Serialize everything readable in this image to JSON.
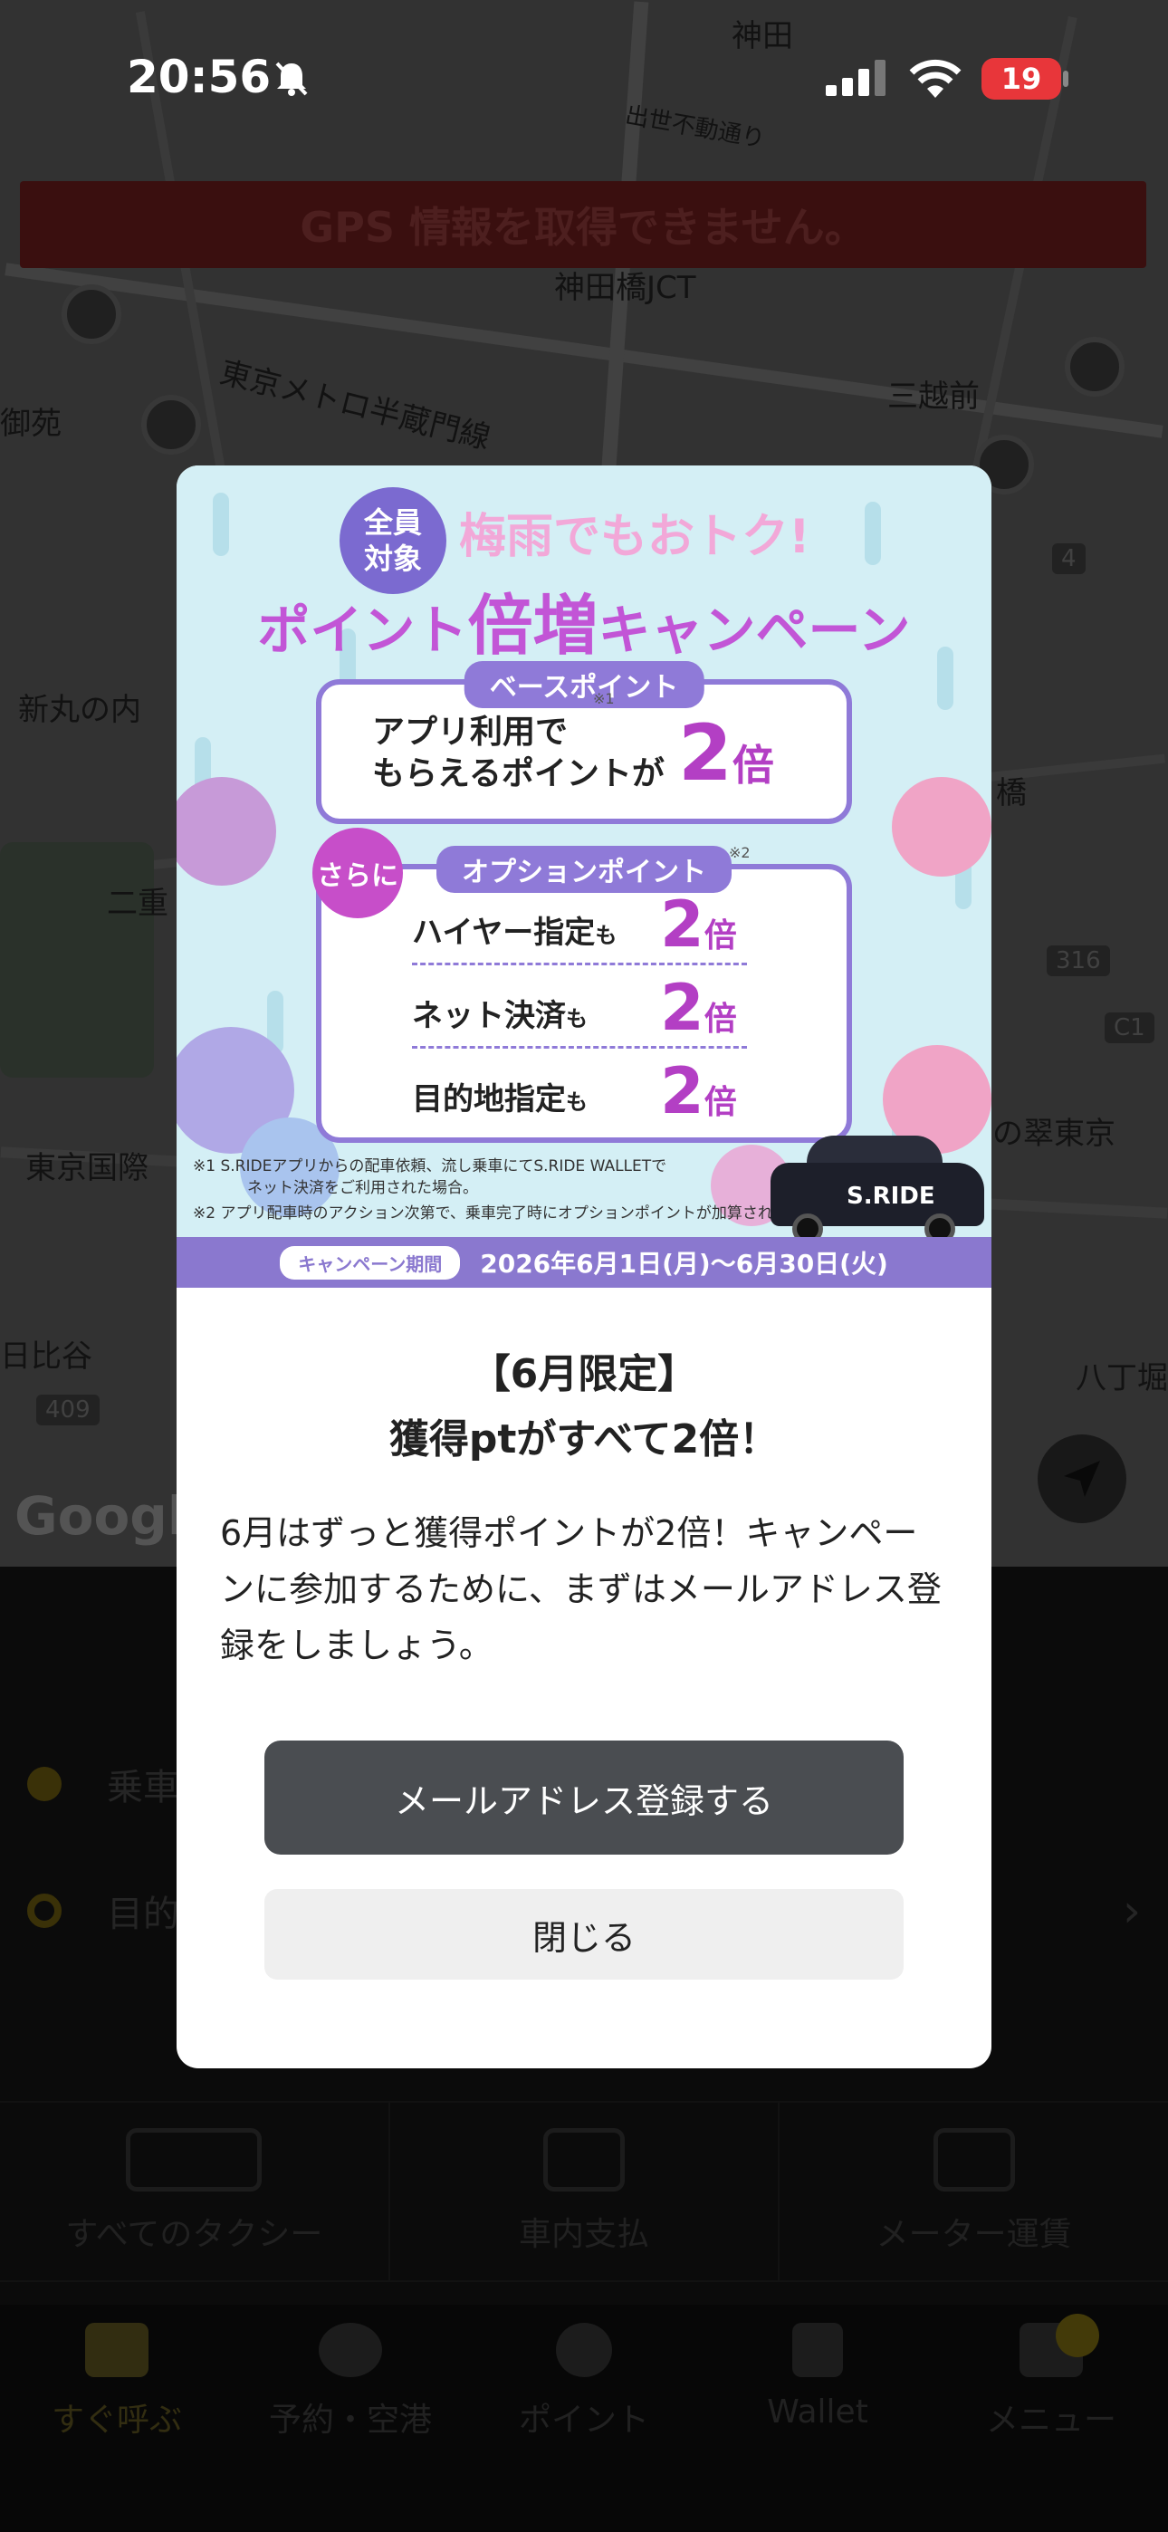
{
  "status_bar": {
    "time": "20:56",
    "battery": "19"
  },
  "map": {
    "gps_warning": "GPS 情報を取得できません。",
    "labels": {
      "kanda": "神田",
      "kandabashi_jct": "神田橋JCT",
      "mitsukoshimae": "三越前",
      "shin_marunouchi": "新丸の内",
      "nijubashi": "二重",
      "tokyo_kokusai": "東京国際",
      "hibiya": "日比谷",
      "hatchobori": "八丁堀",
      "hanzomon_line": "東京メトロ半蔵門線",
      "demachi_dori": "出世不動通り",
      "ote": "御苑",
      "hashi": "橋",
      "tokyo": "の翠東京",
      "route_409": "409",
      "route_316": "316",
      "route_c1": "C1",
      "route_4": "4"
    },
    "google": "Google"
  },
  "app": {
    "pickup_label": "乗車",
    "destination_label": "目的",
    "services": [
      {
        "label": "すべてのタクシー",
        "icon": "taxi-icon"
      },
      {
        "label": "車内支払",
        "icon": "in-car-payment-icon"
      },
      {
        "label": "メーター運賃",
        "icon": "meter-icon"
      }
    ],
    "tabbar": [
      {
        "label": "すぐ呼ぶ",
        "icon": "taxi-call-icon"
      },
      {
        "label": "予約・空港",
        "icon": "reservation-airport-icon"
      },
      {
        "label": "ポイント",
        "icon": "point-icon"
      },
      {
        "label": "Wallet",
        "icon": "wallet-icon"
      },
      {
        "label": "メニュー",
        "icon": "menu-icon"
      }
    ]
  },
  "modal": {
    "banner": {
      "badge_line1": "全員",
      "badge_line2": "対象",
      "tagline": "梅雨でもおトク!",
      "headline_pre": "ポイント",
      "headline_big": "倍増",
      "headline_post": "キャンペーン",
      "base_head": "ベースポイント",
      "base_line1": "アプリ利用",
      "base_line1b": "で",
      "base_line2": "もらえるポイントが",
      "note_mark1": "※1",
      "note_mark2": "※2",
      "multiplier": "2",
      "unit": "倍",
      "sarani": "さらに",
      "option_head": "オプションポイント",
      "options": [
        {
          "label": "ハイヤー指定",
          "suffix": "も"
        },
        {
          "label": "ネット決済",
          "suffix": "も"
        },
        {
          "label": "目的地指定",
          "suffix": "も"
        }
      ],
      "footnote1": "※1 S.RIDEアプリからの配車依頼、流し乗車にてS.RIDE WALLETで",
      "footnote1b": "ネット決済をご利用された場合。",
      "footnote2": "※2 アプリ配車時のアクション次第で、乗車完了時にオプションポイントが加算されます。",
      "taxi_logo": "S.RIDE",
      "period_tag": "キャンペーン期間",
      "period_text": "2026年6月1日(月)～6月30日(火)"
    },
    "title_line1": "【6月限定】",
    "title_line2": "獲得ptがすべて2倍！",
    "description": "6月はずっと獲得ポイントが2倍！キャンペーンに参加するために、まずはメールアドレス登録をしましょう。",
    "primary_button": "メールアドレス登録する",
    "secondary_button": "閉じる"
  },
  "colors": {
    "accent_purple": "#8f7ad8",
    "magenta": "#b33fc4",
    "primary_button": "#4a4d51",
    "battery_red": "#e8363a"
  }
}
